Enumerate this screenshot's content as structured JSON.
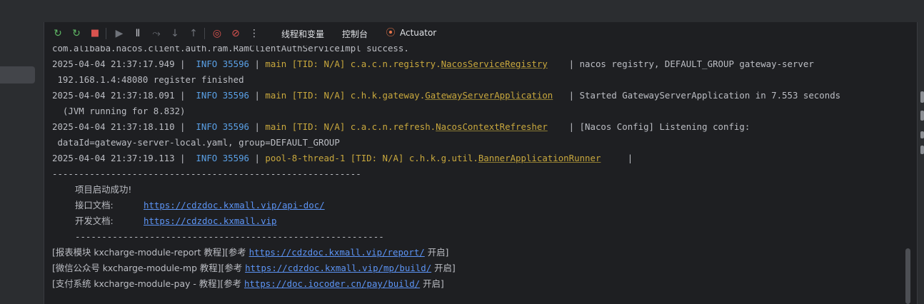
{
  "toolbar": {
    "tabs": {
      "threads": "线程和变量",
      "console": "控制台",
      "actuator": "Actuator"
    },
    "icons": {
      "rerun": "↻",
      "rerun_failed": "↻",
      "stop": "■",
      "resume": "▶",
      "pause": "Ⅱ",
      "step_over": "⤳",
      "step_into": "↓",
      "step_out": "↑",
      "view_breakpoints": "◎",
      "mute_breakpoints": "⊘",
      "more": "⋮",
      "actuator": "⦿"
    }
  },
  "console": {
    "l0": "com.alibaba.nacos.client.auth.ram.RamClientAuthServiceImpl success.",
    "l1": {
      "ts": "2025-04-04 21:37:17.949 |  ",
      "info": "INFO 35596",
      "sep1": " | ",
      "thread": "main [TID: N/A]",
      "pkg": " c.a.c.n.registry.",
      "cls": "NacosServiceRegistry",
      "rest": "    | nacos registry, DEFAULT_GROUP gateway-server"
    },
    "l2": " 192.168.1.4:48080 register finished",
    "l3": {
      "ts": "2025-04-04 21:37:18.091 |  ",
      "info": "INFO 35596",
      "sep1": " | ",
      "thread": "main [TID: N/A]",
      "pkg": " c.h.k.gateway.",
      "cls": "GatewayServerApplication",
      "rest": "   | Started GatewayServerApplication in 7.553 seconds"
    },
    "l4": "  (JVM running for 8.832)",
    "l5": {
      "ts": "2025-04-04 21:37:18.110 |  ",
      "info": "INFO 35596",
      "sep1": " | ",
      "thread": "main [TID: N/A]",
      "pkg": " c.a.c.n.refresh.",
      "cls": "NacosContextRefresher",
      "rest": "    | [Nacos Config] Listening config:"
    },
    "l6": " dataId=gateway-server-local.yaml, group=DEFAULT_GROUP",
    "l7": {
      "ts": "2025-04-04 21:37:19.113 |  ",
      "info": "INFO 35596",
      "sep1": " | ",
      "thread": "pool-8-thread-1 [TID: N/A]",
      "pkg": " c.h.k.g.util.",
      "cls": "BannerApplicationRunner",
      "rest": "     |"
    },
    "l8": "----------------------------------------------------------",
    "l9": "项目启动成功!",
    "l10": {
      "label": "接口文档:",
      "link": "https://cdzdoc.kxmall.vip/api-doc/"
    },
    "l11": {
      "label": "开发文档:",
      "link": "https://cdzdoc.kxmall.vip"
    },
    "l12": "----------------------------------------------------------",
    "l13": {
      "pre": "[报表模块 kxcharge-module-report 教程][参考 ",
      "link": "https://cdzdoc.kxmall.vip/report/",
      "post": " 开启]"
    },
    "l14": {
      "pre": "[微信公众号 kxcharge-module-mp 教程][参考 ",
      "link": "https://cdzdoc.kxmall.vip/mp/build/",
      "post": " 开启]"
    },
    "l15": {
      "pre": "[支付系统 kxcharge-module-pay - 教程][参考 ",
      "link": "https://doc.iocoder.cn/pay/build/",
      "post": " 开启]"
    }
  },
  "colors": {
    "background": "#1e1f22",
    "panel": "#2b2d30",
    "info": "#5aa0e6",
    "thread": "#c9a83d",
    "link": "#5c94f5",
    "text": "#bcbec4",
    "rerun": "#5fb865",
    "stop": "#d9534f"
  }
}
